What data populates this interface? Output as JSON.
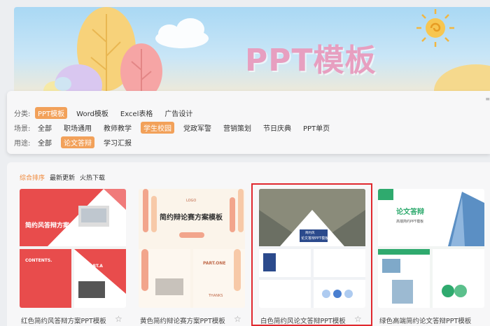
{
  "banner": {
    "title": "PPT模板"
  },
  "filters": {
    "rows": [
      {
        "label": "分类:",
        "options": [
          "PPT模板",
          "Word模板",
          "Excel表格",
          "广告设计"
        ],
        "active": 0
      },
      {
        "label": "场景:",
        "options": [
          "全部",
          "职场通用",
          "教师教学",
          "学生校园",
          "党政军警",
          "营销策划",
          "节日庆典",
          "PPT单页"
        ],
        "active": 3
      },
      {
        "label": "用途:",
        "options": [
          "全部",
          "论文答辩",
          "学习汇报"
        ],
        "active": 1
      }
    ]
  },
  "sort": {
    "options": [
      "综合排序",
      "最新更新",
      "火热下载"
    ],
    "active": 0
  },
  "cards": [
    {
      "title": "红色简约风答辩方案PPT模板",
      "thumb_text": [
        "简约风答辩方案",
        "CONTENTS.",
        "PART.A"
      ]
    },
    {
      "title": "黄色简约辩论赛方案PPT模板",
      "thumb_text": [
        "LOGO",
        "简约辩论赛方案模板",
        "PART.ONE",
        "THANKS"
      ]
    },
    {
      "title": "白色简约风论文答辩PPT模板",
      "thumb_text": [
        "简约风",
        "论文答辩PPT模板"
      ]
    },
    {
      "title": "绿色高端简约论文答辩PPT模板",
      "thumb_text": [
        "论文答辩",
        "高端简约PPT模板"
      ]
    }
  ],
  "colors": {
    "accent": "#f2a15a",
    "sort_active": "#f08a3c",
    "selection": "#e0282e"
  }
}
